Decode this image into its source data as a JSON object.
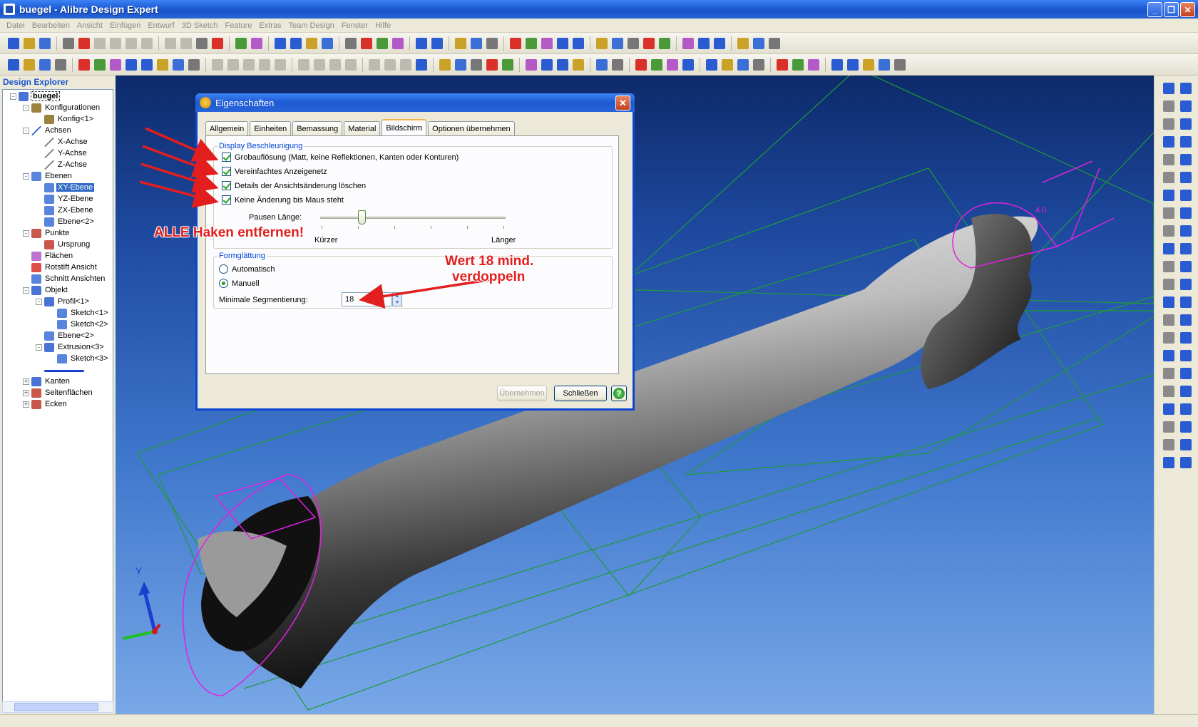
{
  "window": {
    "title": "buegel - Alibre Design Expert",
    "controls": [
      "_",
      "❐",
      "✕"
    ]
  },
  "menu": [
    "Datei",
    "Bearbeiten",
    "Ansicht",
    "Einfügen",
    "Entwurf",
    "3D Sketch",
    "Feature",
    "Extras",
    "Team Design",
    "Fenster",
    "Hilfe"
  ],
  "explorer": {
    "title": "Design Explorer",
    "tree": [
      {
        "label": "buegel",
        "level": 0,
        "toggle": "-",
        "icon": "part-icon",
        "color": "#2a5bd0",
        "style": "bold"
      },
      {
        "label": "Konfigurationen",
        "level": 1,
        "toggle": "-",
        "icon": "table-icon",
        "color": "#8a6d1c"
      },
      {
        "label": "Konfig<1>",
        "level": 2,
        "toggle": "",
        "icon": "table-icon",
        "color": "#8a6d1c"
      },
      {
        "label": "Achsen",
        "level": 1,
        "toggle": "-",
        "icon": "axis-icon",
        "color": "#2a5bd0"
      },
      {
        "label": "X-Achse",
        "level": 2,
        "toggle": "",
        "icon": "axis-icon",
        "color": "#777"
      },
      {
        "label": "Y-Achse",
        "level": 2,
        "toggle": "",
        "icon": "axis-icon",
        "color": "#777"
      },
      {
        "label": "Z-Achse",
        "level": 2,
        "toggle": "",
        "icon": "axis-icon",
        "color": "#777"
      },
      {
        "label": "Ebenen",
        "level": 1,
        "toggle": "-",
        "icon": "plane-icon",
        "color": "#3b6fd6"
      },
      {
        "label": "XY-Ebene",
        "level": 2,
        "toggle": "",
        "icon": "plane-icon",
        "color": "#3b6fd6",
        "style": "selected"
      },
      {
        "label": "YZ-Ebene",
        "level": 2,
        "toggle": "",
        "icon": "plane-icon",
        "color": "#3b6fd6"
      },
      {
        "label": "ZX-Ebene",
        "level": 2,
        "toggle": "",
        "icon": "plane-icon",
        "color": "#3b6fd6"
      },
      {
        "label": "Ebene<2>",
        "level": 2,
        "toggle": "",
        "icon": "plane-icon",
        "color": "#3b6fd6"
      },
      {
        "label": "Punkte",
        "level": 1,
        "toggle": "-",
        "icon": "point-icon",
        "color": "#c0392b"
      },
      {
        "label": "Ursprung",
        "level": 2,
        "toggle": "",
        "icon": "point-icon",
        "color": "#c0392b"
      },
      {
        "label": "Flächen",
        "level": 1,
        "toggle": "",
        "icon": "surface-icon",
        "color": "#b45ac8"
      },
      {
        "label": "Rotstift Ansicht",
        "level": 1,
        "toggle": "",
        "icon": "redline-icon",
        "color": "#d9302a"
      },
      {
        "label": "Schnitt Ansichten",
        "level": 1,
        "toggle": "",
        "icon": "section-icon",
        "color": "#3b6fd6"
      },
      {
        "label": "Objekt",
        "level": 1,
        "toggle": "-",
        "icon": "solid-icon",
        "color": "#2a5bd0"
      },
      {
        "label": "Profil<1>",
        "level": 2,
        "toggle": "-",
        "icon": "profile-icon",
        "color": "#2a5bd0"
      },
      {
        "label": "Sketch<1>",
        "level": 3,
        "toggle": "",
        "icon": "sketch-icon",
        "color": "#3b6fd6"
      },
      {
        "label": "Sketch<2>",
        "level": 3,
        "toggle": "",
        "icon": "sketch-icon",
        "color": "#3b6fd6"
      },
      {
        "label": "Ebene<2>",
        "level": 2,
        "toggle": "",
        "icon": "plane-icon",
        "color": "#3b6fd6"
      },
      {
        "label": "Extrusion<3>",
        "level": 2,
        "toggle": "-",
        "icon": "extrusion-icon",
        "color": "#2a5bd0"
      },
      {
        "label": "Sketch<3>",
        "level": 3,
        "toggle": "",
        "icon": "sketch-icon",
        "color": "#3b6fd6"
      },
      {
        "label": "",
        "level": 2,
        "toggle": "",
        "icon": "end-marker-icon",
        "color": "#1b3fd0"
      },
      {
        "label": "Kanten",
        "level": 1,
        "toggle": "+",
        "icon": "edges-icon",
        "color": "#2a5bd0"
      },
      {
        "label": "Seitenflächen",
        "level": 1,
        "toggle": "+",
        "icon": "faces-icon",
        "color": "#c0392b"
      },
      {
        "label": "Ecken",
        "level": 1,
        "toggle": "+",
        "icon": "vertices-icon",
        "color": "#c0392b"
      }
    ]
  },
  "dialog": {
    "title": "Eigenschaften",
    "close": "✕",
    "tabs": [
      "Allgemein",
      "Einheiten",
      "Bemassung",
      "Material",
      "Bildschirm",
      "Optionen übernehmen"
    ],
    "active_tab": "Bildschirm",
    "display_group": {
      "legend": "Display Beschleunigung",
      "checkboxes": [
        {
          "label": "Grobauflösung (Matt, keine Reflektionen, Kanten oder Konturen)",
          "checked": true
        },
        {
          "label": "Vereinfachtes Anzeigenetz",
          "checked": true
        },
        {
          "label": "Details der Ansichtsänderung löschen",
          "checked": true
        },
        {
          "label": "Keine Änderung bis Maus steht",
          "checked": true
        }
      ],
      "slider_label": "Pausen Länge:",
      "slider_min_label": "Kürzer",
      "slider_max_label": "Länger",
      "slider_value": 0.21
    },
    "smoothing_group": {
      "legend": "Formglättung",
      "radio_auto": "Automatisch",
      "radio_manual": "Manuell",
      "selected": "Manuell",
      "segment_label": "Minimale Segmentierung:",
      "segment_value": "18"
    },
    "buttons": {
      "apply": "Übernehmen",
      "close": "Schließen",
      "help": "?"
    }
  },
  "annotations": {
    "remove_all": "ALLE Haken entfernen!",
    "double_line1": "Wert 18 mind.",
    "double_line2": "verdoppeln",
    "color": "#e31e1e"
  },
  "viewport": {
    "dimension_label": "4.0",
    "axis_label_y": "Y"
  }
}
